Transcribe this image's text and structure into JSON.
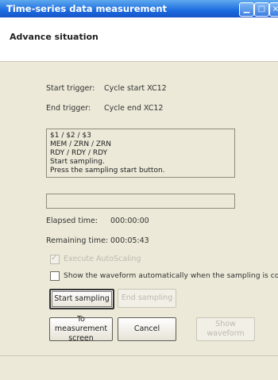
{
  "window": {
    "title": "Time-series data measurement"
  },
  "header": {
    "title": "Advance situation"
  },
  "triggers": {
    "start_label": "Start trigger:",
    "start_value": "Cycle start XC12",
    "end_label": "End trigger:",
    "end_value": "Cycle end XC12"
  },
  "message": {
    "lines": [
      "$1  / $2  / $3",
      "MEM / ZRN / ZRN",
      "RDY / RDY / RDY",
      "Start sampling.",
      "Press the sampling start button."
    ]
  },
  "progress": {
    "fraction": 0
  },
  "times": {
    "elapsed_label": "Elapsed time:",
    "elapsed_value": "000:00:00",
    "remaining_label": "Remaining time:",
    "remaining_value": "000:05:43"
  },
  "options": {
    "autoscaling_label": "Execute AutoScaling",
    "autoscaling_checked": true,
    "autoscaling_enabled": false,
    "show_waveform_label": "Show the waveform automatically when the sampling is complete",
    "show_waveform_checked": false
  },
  "buttons": {
    "start_sampling": "Start sampling",
    "end_sampling": "End sampling",
    "to_measurement_line1": "To measurement",
    "to_measurement_line2": "screen",
    "cancel": "Cancel",
    "show_waveform": "Show waveform"
  }
}
